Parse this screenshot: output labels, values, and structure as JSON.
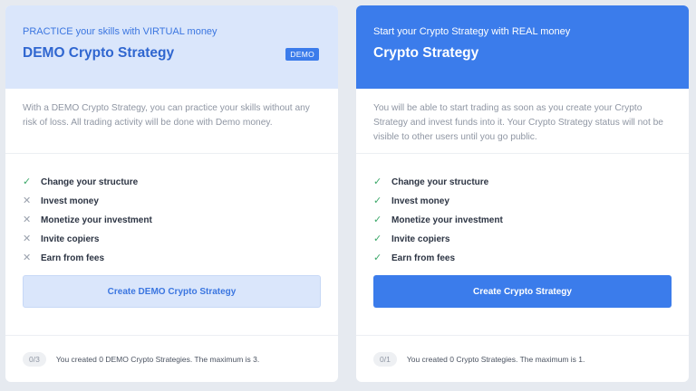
{
  "demo": {
    "subtitle": "PRACTICE your skills with VIRTUAL money",
    "title": "DEMO Crypto Strategy",
    "badge": "DEMO",
    "description": "With a DEMO Crypto Strategy, you can practice your skills without any risk of loss. All trading activity will be done with Demo money.",
    "features": [
      {
        "label": "Change your structure",
        "icon": "check-icon"
      },
      {
        "label": "Invest money",
        "icon": "cross-icon"
      },
      {
        "label": "Monetize your investment",
        "icon": "cross-icon"
      },
      {
        "label": "Invite copiers",
        "icon": "cross-icon"
      },
      {
        "label": "Earn from fees",
        "icon": "cross-icon"
      }
    ],
    "button_label": "Create DEMO Crypto Strategy",
    "counter": "0/3",
    "footer_text": "You created 0 DEMO Crypto Strategies. The maximum is 3."
  },
  "real": {
    "subtitle": "Start your Crypto Strategy with REAL money",
    "title": "Crypto Strategy",
    "description": "You will be able to start trading as soon as you create your Crypto Strategy and invest funds into it. Your Crypto Strategy status will not be visible to other users until you go public.",
    "features": [
      {
        "label": "Change your structure",
        "icon": "check-icon"
      },
      {
        "label": "Invest money",
        "icon": "check-icon"
      },
      {
        "label": "Monetize your investment",
        "icon": "check-icon"
      },
      {
        "label": "Invite copiers",
        "icon": "check-icon"
      },
      {
        "label": "Earn from fees",
        "icon": "check-icon"
      }
    ],
    "button_label": "Create Crypto Strategy",
    "counter": "0/1",
    "footer_text": "You created 0 Crypto Strategies. The maximum is 1."
  },
  "colors": {
    "accent": "#3b7ceb",
    "demo_header": "#dae6fb",
    "check": "#3ca86a",
    "cross": "#9aa1ad"
  }
}
